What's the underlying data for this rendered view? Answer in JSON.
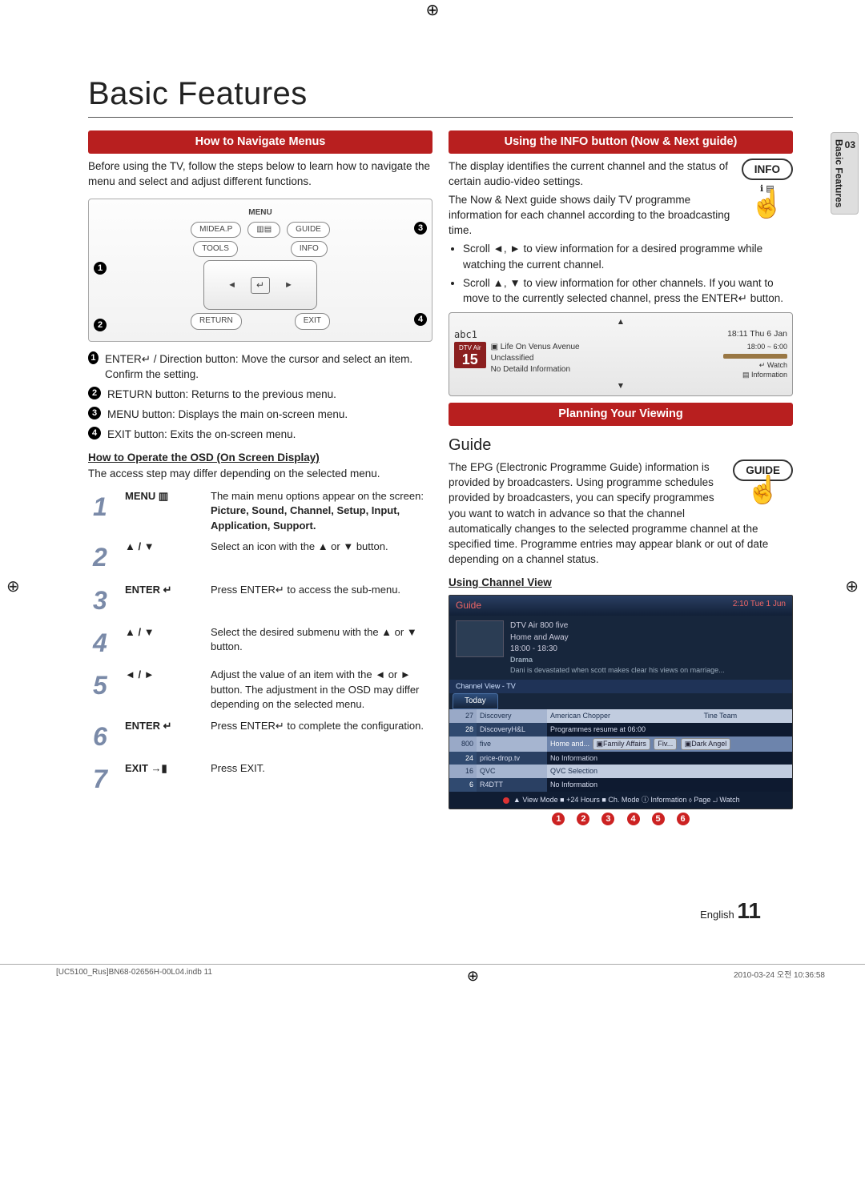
{
  "side_tab": {
    "number": "03",
    "label": "Basic Features"
  },
  "page_title": "Basic Features",
  "left": {
    "heading_nav": "How to Navigate Menus",
    "intro": "Before using the TV, follow the steps below to learn how to navigate the menu and select and adjust different functions.",
    "remote": {
      "menu_label": "MENU",
      "row1": [
        "MIDEA.P",
        "▥▤",
        "GUIDE"
      ],
      "row2_left": "TOOLS",
      "row2_right": "INFO",
      "dpad_left": "◄",
      "dpad_mid": "↵",
      "dpad_right": "►",
      "row4_left": "RETURN",
      "row4_right": "EXIT"
    },
    "callouts": [
      {
        "n": "1",
        "text": "ENTER↵ / Direction button: Move the cursor and select an item. Confirm the setting."
      },
      {
        "n": "2",
        "text": "RETURN button: Returns to the previous menu."
      },
      {
        "n": "3",
        "text": "MENU button: Displays the main on-screen menu."
      },
      {
        "n": "4",
        "text": "EXIT button: Exits the on-screen menu."
      }
    ],
    "osd_head": "How to Operate the OSD (On Screen Display)",
    "osd_note": "The access step may differ depending on the selected menu.",
    "steps": [
      {
        "n": "1",
        "label": "MENU ▥",
        "desc": "The main menu options appear on the screen:",
        "bold": "Picture, Sound, Channel, Setup, Input, Application, Support."
      },
      {
        "n": "2",
        "label": "▲ / ▼",
        "desc": "Select an icon with the ▲ or ▼ button."
      },
      {
        "n": "3",
        "label": "ENTER ↵",
        "desc": "Press ENTER↵ to access the sub-menu."
      },
      {
        "n": "4",
        "label": "▲ / ▼",
        "desc": "Select the desired submenu with the ▲ or ▼ button."
      },
      {
        "n": "5",
        "label": "◄ / ►",
        "desc": "Adjust the value of an item with the ◄ or ► button. The adjustment in the OSD may differ depending on the selected menu."
      },
      {
        "n": "6",
        "label": "ENTER ↵",
        "desc": "Press ENTER↵ to complete the configuration."
      },
      {
        "n": "7",
        "label": "EXIT →▮",
        "desc": "Press EXIT."
      }
    ]
  },
  "right": {
    "heading_info": "Using the INFO button (Now & Next guide)",
    "info_btn_label": "INFO",
    "para1": "The display identifies the current channel and the status of certain audio-video settings.",
    "para2": "The Now & Next guide shows daily TV programme information for each channel according to the broadcasting time.",
    "bullets": [
      "Scroll ◄, ► to view information for a desired programme while watching the current channel.",
      "Scroll ▲, ▼ to view information for other channels. If you want to move to the currently selected channel, press the ENTER↵ button."
    ],
    "nownext": {
      "head": "abc1",
      "time_right": "18:11 Thu 6 Jan",
      "ch_label": "DTV Air",
      "ch_num": "15",
      "prog": "Life On Venus Avenue",
      "prog_time": "18:00 ~ 6:00",
      "line1": "Unclassified",
      "line2": "No Detaild Information",
      "hints": [
        "↵ Watch",
        "▤ Information"
      ]
    },
    "heading_plan": "Planning Your Viewing",
    "guide_title": "Guide",
    "guide_btn_label": "GUIDE",
    "guide_para": "The EPG (Electronic Programme Guide) information is provided by broadcasters. Using programme schedules provided by broadcasters, you can specify programmes you want to watch in advance so that the channel automatically changes to the selected programme channel at the specified time. Programme entries may appear blank or out of date depending on a channel status.",
    "using_cv": "Using  Channel View",
    "epg": {
      "title": "Guide",
      "clock": "2:10 Tue 1 Jun",
      "info_title": "DTV Air 800 five",
      "info_sub": "Home and Away",
      "info_time": "18:00 - 18:30",
      "info_genre": "Drama",
      "info_desc": "Dani is devastated when scott makes clear his views on marriage...",
      "section": "Channel View - TV",
      "tab": "Today",
      "rows": [
        {
          "num": "27",
          "name": "Discovery",
          "cells": [
            "American Chopper",
            "Tine Team"
          ]
        },
        {
          "num": "28",
          "name": "DiscoveryH&L",
          "cells": [
            "Programmes resume at 06:00"
          ]
        },
        {
          "num": "800",
          "name": "five",
          "cells": [
            "Home and...",
            "▣Family Affairs",
            "Fiv...",
            "▣Dark Angel"
          ]
        },
        {
          "num": "24",
          "name": "price-drop.tv",
          "cells": [
            "No Information"
          ]
        },
        {
          "num": "16",
          "name": "QVC",
          "cells": [
            "QVC Selection"
          ]
        },
        {
          "num": "6",
          "name": "R4DTT",
          "cells": [
            "No Information"
          ]
        }
      ],
      "legend": "▲ View Mode ■ +24 Hours ■ Ch. Mode ⓘ Information ⬨ Page ↵ Watch",
      "legend_nums": [
        "1",
        "2",
        "3",
        "4",
        "5",
        "6"
      ]
    }
  },
  "footer": {
    "lang": "English",
    "page_num": "11",
    "print_left": "[UC5100_Rus]BN68-02656H-00L04.indb   11",
    "print_right": "2010-03-24   오전 10:36:58"
  }
}
